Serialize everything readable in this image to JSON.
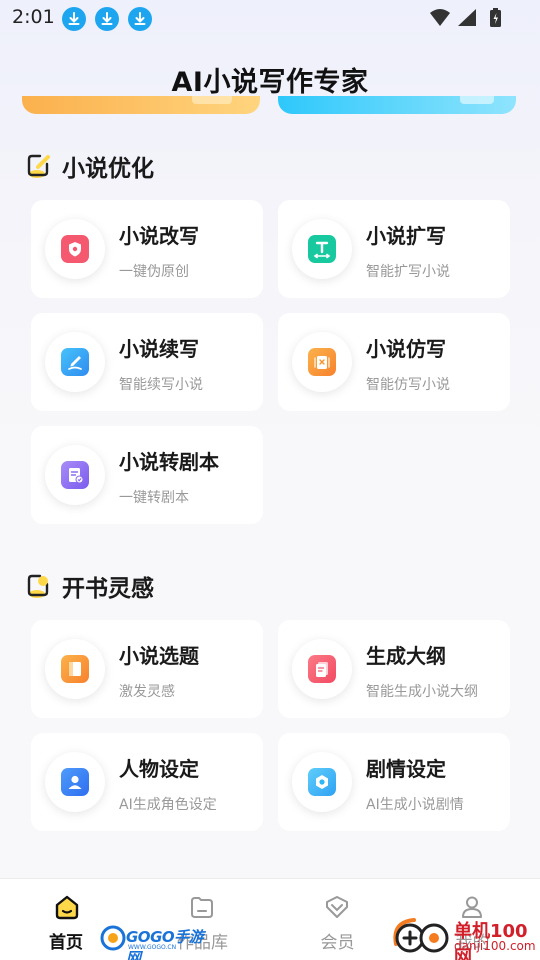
{
  "status_bar": {
    "time": "2:01"
  },
  "header": {
    "title": "AI小说写作专家"
  },
  "sections": [
    {
      "title": "小说优化",
      "cards": [
        {
          "title": "小说改写",
          "subtitle": "一键伪原创",
          "icon": "shield-icon",
          "color": "#f5596f"
        },
        {
          "title": "小说扩写",
          "subtitle": "智能扩写小说",
          "icon": "text-expand-icon",
          "color": "#18c9a0"
        },
        {
          "title": "小说续写",
          "subtitle": "智能续写小说",
          "icon": "pen-icon",
          "color": "#2fa9f5"
        },
        {
          "title": "小说仿写",
          "subtitle": "智能仿写小说",
          "icon": "copy-icon",
          "color": "#f7932d"
        },
        {
          "title": "小说转剧本",
          "subtitle": "一键转剧本",
          "icon": "script-icon",
          "color": "#8b6cf0"
        }
      ]
    },
    {
      "title": "开书灵感",
      "cards": [
        {
          "title": "小说选题",
          "subtitle": "激发灵感",
          "icon": "book-icon",
          "color": "#f7932d"
        },
        {
          "title": "生成大纲",
          "subtitle": "智能生成小说大纲",
          "icon": "outline-icon",
          "color": "#f5596f"
        },
        {
          "title": "人物设定",
          "subtitle": "AI生成角色设定",
          "icon": "person-icon",
          "color": "#3a82f6"
        },
        {
          "title": "剧情设定",
          "subtitle": "AI生成小说剧情",
          "icon": "gear-icon",
          "color": "#2fb6f5"
        }
      ]
    }
  ],
  "tab_bar": {
    "tabs": [
      {
        "label": "首页",
        "icon": "home-icon",
        "active": true
      },
      {
        "label": "作品库",
        "icon": "folder-icon",
        "active": false
      },
      {
        "label": "会员",
        "icon": "vip-icon",
        "active": false
      },
      {
        "label": "我的",
        "icon": "user-icon",
        "active": false
      }
    ]
  },
  "watermarks": {
    "gogo": {
      "name": "GOGO手游网",
      "url": "WWW.GOGO.CN"
    },
    "danji": {
      "name": "单机100网",
      "url": "danji100.com"
    }
  },
  "colors": {
    "accent_yellow": "#ffd84a",
    "download_blue": "#1ea5f0"
  }
}
